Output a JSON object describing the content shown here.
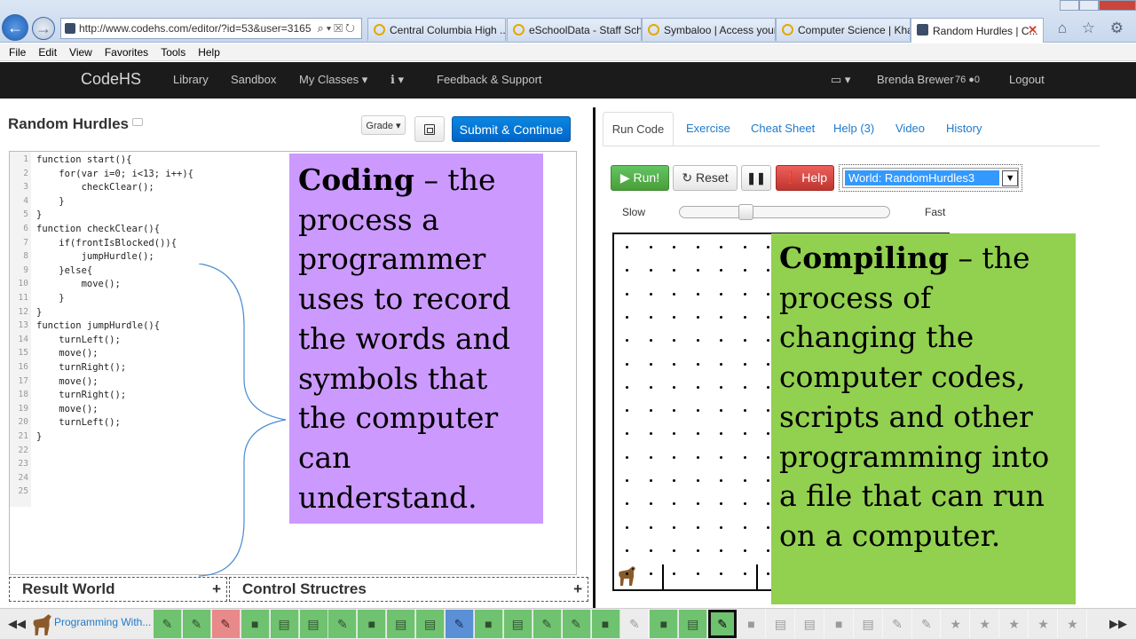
{
  "browser": {
    "url": "http://www.codehs.com/editor/?id=53&user=3165",
    "tabs": [
      {
        "label": "Central Columbia High ..."
      },
      {
        "label": "eSchoolData - Staff Sch..."
      },
      {
        "label": "Symbaloo | Access your..."
      },
      {
        "label": "Computer Science | Kha..."
      },
      {
        "label": "Random Hurdles | C..."
      }
    ],
    "close_glyph": "✕",
    "toolbar_icons": "⌂ ☆ ⚙"
  },
  "menu": [
    "File",
    "Edit",
    "View",
    "Favorites",
    "Tools",
    "Help"
  ],
  "nav": {
    "brand": "CodeHS",
    "items": [
      "Library",
      "Sandbox",
      "My Classes ▾",
      "ℹ ▾",
      "Feedback & Support"
    ],
    "profile_icon": "▭ ▾",
    "user": "Brenda Brewer",
    "points": "76 ●0",
    "logout": "Logout"
  },
  "editor_panel": {
    "title": "Random Hurdles",
    "grade_label": "Grade ▾",
    "submit_label": "Submit & Continue",
    "code_lines": [
      "function start(){",
      "    for(var i=0; i<13; i++){",
      "        checkClear();",
      "    }",
      "}",
      "function checkClear(){",
      "    if(frontIsBlocked()){",
      "        jumpHurdle();",
      "    }else{",
      "        move();",
      "    }",
      "}",
      "function jumpHurdle(){",
      "    turnLeft();",
      "    move();",
      "    turnRight();",
      "    move();",
      "    turnRight();",
      "    move();",
      "    turnLeft();",
      "}",
      "",
      "",
      "",
      ""
    ],
    "bottom_boxes": [
      {
        "label": "Result World",
        "plus": "+"
      },
      {
        "label": "Control Structres",
        "plus": "+"
      }
    ]
  },
  "definitions": {
    "coding": {
      "term": "Coding",
      "text": " – the process a programmer uses to record the words and symbols that the computer can understand."
    },
    "compiling": {
      "term": "Compiling",
      "text": " – the process of changing the computer codes, scripts and other programming into a file that can run on a computer."
    }
  },
  "run_panel": {
    "tabs": [
      "Run Code",
      "Exercise",
      "Cheat Sheet",
      "Help (3)",
      "Video",
      "History"
    ],
    "run_label": "▶ Run!",
    "reset_label": "↻ Reset",
    "pause_label": "❚❚",
    "help_label": "❗ Help",
    "world_selected": "World: RandomHurdles3",
    "slow_label": "Slow",
    "fast_label": "Fast",
    "speed_fraction": 0.3
  },
  "activity_bar": {
    "label": "Programming With...",
    "items": [
      {
        "icon": "pencil-icon",
        "glyph": "✎",
        "state": "green"
      },
      {
        "icon": "pencil-icon",
        "glyph": "✎",
        "state": "green"
      },
      {
        "icon": "pencil-icon",
        "glyph": "✎",
        "state": "red"
      },
      {
        "icon": "video-icon",
        "glyph": "■",
        "state": "green"
      },
      {
        "icon": "document-icon",
        "glyph": "▤",
        "state": "green"
      },
      {
        "icon": "document-icon",
        "glyph": "▤",
        "state": "green"
      },
      {
        "icon": "pencil-icon",
        "glyph": "✎",
        "state": "green"
      },
      {
        "icon": "video-icon",
        "glyph": "■",
        "state": "green"
      },
      {
        "icon": "document-icon",
        "glyph": "▤",
        "state": "green"
      },
      {
        "icon": "document-icon",
        "glyph": "▤",
        "state": "green"
      },
      {
        "icon": "pencil-icon",
        "glyph": "✎",
        "state": "blue"
      },
      {
        "icon": "video-icon",
        "glyph": "■",
        "state": "green"
      },
      {
        "icon": "document-icon",
        "glyph": "▤",
        "state": "green"
      },
      {
        "icon": "pencil-icon",
        "glyph": "✎",
        "state": "green"
      },
      {
        "icon": "pencil-icon",
        "glyph": "✎",
        "state": "green"
      },
      {
        "icon": "video-icon",
        "glyph": "■",
        "state": "green"
      },
      {
        "icon": "edit-icon",
        "glyph": "✎",
        "state": "grey"
      },
      {
        "icon": "video-icon",
        "glyph": "■",
        "state": "green"
      },
      {
        "icon": "document-icon",
        "glyph": "▤",
        "state": "green"
      },
      {
        "icon": "pencil-icon",
        "glyph": "✎",
        "state": "current"
      },
      {
        "icon": "video-icon",
        "glyph": "■",
        "state": "grey"
      },
      {
        "icon": "document-icon",
        "glyph": "▤",
        "state": "grey"
      },
      {
        "icon": "document-icon",
        "glyph": "▤",
        "state": "grey"
      },
      {
        "icon": "video-icon",
        "glyph": "■",
        "state": "grey"
      },
      {
        "icon": "document-icon",
        "glyph": "▤",
        "state": "grey"
      },
      {
        "icon": "pencil-icon",
        "glyph": "✎",
        "state": "grey"
      },
      {
        "icon": "pencil-icon",
        "glyph": "✎",
        "state": "grey"
      },
      {
        "icon": "star-icon",
        "glyph": "★",
        "state": "grey"
      },
      {
        "icon": "star-icon",
        "glyph": "★",
        "state": "grey"
      },
      {
        "icon": "star-icon",
        "glyph": "★",
        "state": "grey"
      },
      {
        "icon": "star-icon",
        "glyph": "★",
        "state": "grey"
      },
      {
        "icon": "star-icon",
        "glyph": "★",
        "state": "grey"
      }
    ]
  }
}
